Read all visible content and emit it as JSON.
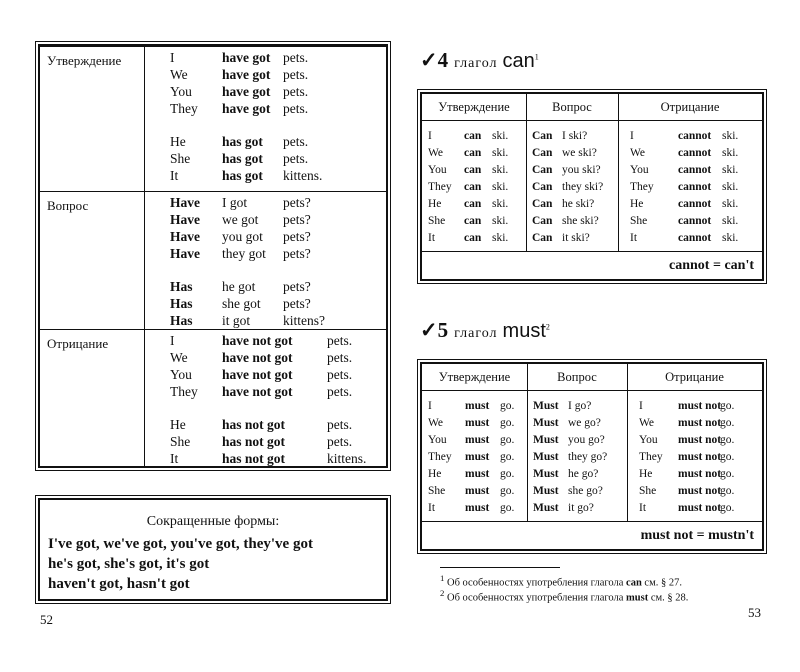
{
  "left_table": {
    "sections": [
      {
        "label": "Утверждение",
        "kind": "aff",
        "rows": [
          [
            "I",
            "have got",
            "pets."
          ],
          [
            "We",
            "have got",
            "pets."
          ],
          [
            "You",
            "have got",
            "pets."
          ],
          [
            "They",
            "have got",
            "pets."
          ],
          [
            "He",
            "has got",
            "pets."
          ],
          [
            "She",
            "has got",
            "pets."
          ],
          [
            "It",
            "has got",
            "kittens."
          ]
        ]
      },
      {
        "label": "Вопрос",
        "kind": "q",
        "rows": [
          [
            "Have",
            "I got",
            "pets?"
          ],
          [
            "Have",
            "we got",
            "pets?"
          ],
          [
            "Have",
            "you got",
            "pets?"
          ],
          [
            "Have",
            "they got",
            "pets?"
          ],
          [
            "Has",
            "he got",
            "pets?"
          ],
          [
            "Has",
            "she got",
            "pets?"
          ],
          [
            "Has",
            "it got",
            "kittens?"
          ]
        ]
      },
      {
        "label": "Отрицание",
        "kind": "neg",
        "rows": [
          [
            "I",
            "have not got",
            "pets."
          ],
          [
            "We",
            "have not got",
            "pets."
          ],
          [
            "You",
            "have not got",
            "pets."
          ],
          [
            "They",
            "have not got",
            "pets."
          ],
          [
            "He",
            "has not got",
            "pets."
          ],
          [
            "She",
            "has not got",
            "pets."
          ],
          [
            "It",
            "has not got",
            "kittens."
          ]
        ]
      }
    ]
  },
  "short_forms": {
    "title": "Сокращенные формы:",
    "lines": [
      "I've got, we've got, you've got, they've got",
      "he's got, she's got, it's got",
      "haven't got, hasn't got"
    ]
  },
  "can_section": {
    "check": "✓4",
    "word": "глагол",
    "verb": "can",
    "sup": "1",
    "headers": [
      "Утверждение",
      "Вопрос",
      "Отрицание"
    ],
    "affirmative": [
      [
        "I",
        "can",
        "ski."
      ],
      [
        "We",
        "can",
        "ski."
      ],
      [
        "You",
        "can",
        "ski."
      ],
      [
        "They",
        "can",
        "ski."
      ],
      [
        "He",
        "can",
        "ski."
      ],
      [
        "She",
        "can",
        "ski."
      ],
      [
        "It",
        "can",
        "ski."
      ]
    ],
    "question": [
      [
        "Can",
        "I ski?"
      ],
      [
        "Can",
        "we ski?"
      ],
      [
        "Can",
        "you ski?"
      ],
      [
        "Can",
        "they ski?"
      ],
      [
        "Can",
        "he ski?"
      ],
      [
        "Can",
        "she ski?"
      ],
      [
        "Can",
        "it ski?"
      ]
    ],
    "negative": [
      [
        "I",
        "cannot",
        "ski."
      ],
      [
        "We",
        "cannot",
        "ski."
      ],
      [
        "You",
        "cannot",
        "ski."
      ],
      [
        "They",
        "cannot",
        "ski."
      ],
      [
        "He",
        "cannot",
        "ski."
      ],
      [
        "She",
        "cannot",
        "ski."
      ],
      [
        "It",
        "cannot",
        "ski."
      ]
    ],
    "footer": "cannot = can't"
  },
  "must_section": {
    "check": "✓5",
    "word": "глагол",
    "verb": "must",
    "sup": "2",
    "headers": [
      "Утверждение",
      "Вопрос",
      "Отрицание"
    ],
    "affirmative": [
      [
        "I",
        "must",
        "go."
      ],
      [
        "We",
        "must",
        "go."
      ],
      [
        "You",
        "must",
        "go."
      ],
      [
        "They",
        "must",
        "go."
      ],
      [
        "He",
        "must",
        "go."
      ],
      [
        "She",
        "must",
        "go."
      ],
      [
        "It",
        "must",
        "go."
      ]
    ],
    "question": [
      [
        "Must",
        "I go?"
      ],
      [
        "Must",
        "we go?"
      ],
      [
        "Must",
        "you go?"
      ],
      [
        "Must",
        "they go?"
      ],
      [
        "Must",
        "he go?"
      ],
      [
        "Must",
        "she go?"
      ],
      [
        "Must",
        "it go?"
      ]
    ],
    "negative": [
      [
        "I",
        "must not",
        "go."
      ],
      [
        "We",
        "must not",
        "go."
      ],
      [
        "You",
        "must not",
        "go."
      ],
      [
        "They",
        "must not",
        "go."
      ],
      [
        "He",
        "must not",
        "go."
      ],
      [
        "She",
        "must not",
        "go."
      ],
      [
        "It",
        "must not",
        "go."
      ]
    ],
    "footer": "must not = mustn't"
  },
  "footnotes": [
    {
      "num": "1",
      "pre": "Об особенностях употребления глагола",
      "verb": "can",
      "post": "см. § 27."
    },
    {
      "num": "2",
      "pre": "Об особенностях употребления глагола",
      "verb": "must",
      "post": "см. § 28."
    }
  ],
  "page_numbers": {
    "left": "52",
    "right": "53"
  }
}
